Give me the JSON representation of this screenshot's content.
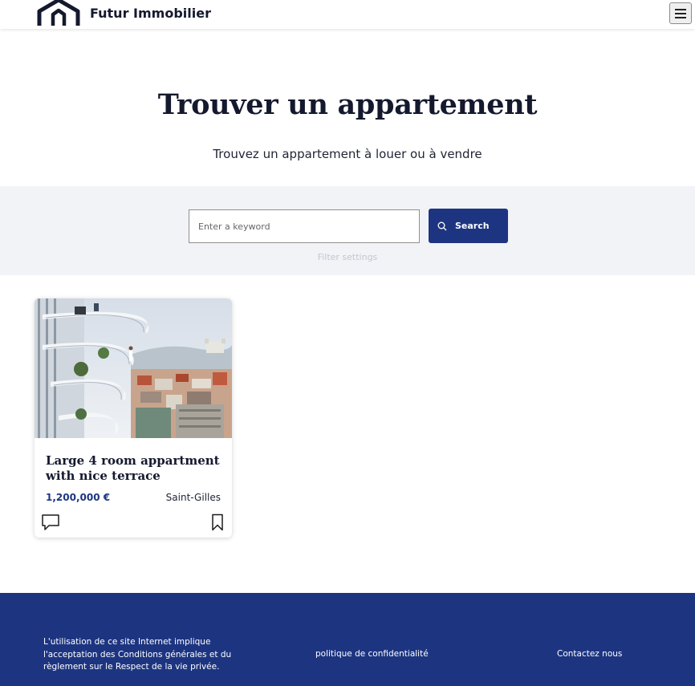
{
  "header": {
    "brand": "Futur Immobilier",
    "logo_icon": "house-outline-icon",
    "menu_icon": "hamburger-menu-icon"
  },
  "hero": {
    "title": "Trouver un appartement",
    "subtitle": "Trouvez un appartement à louer ou à vendre"
  },
  "search": {
    "placeholder": "Enter a keyword",
    "value": "",
    "button_label": "Search",
    "button_icon": "search-icon",
    "filter_link": "Filter settings"
  },
  "listings": [
    {
      "title": "Large 4 room appartment with nice terrace",
      "price": "1,200,000 €",
      "city": "Saint-Gilles",
      "image": "apartment-tower-balconies-photo",
      "icons": [
        "comment-icon",
        "bookmark-icon"
      ]
    }
  ],
  "footer": {
    "legal": "L'utilisation de ce site Internet implique l'acceptation des Conditions générales et du règlement sur le Respect de la vie privée.",
    "privacy": "politique de confidentialité",
    "contact": "Contactez nous"
  },
  "colors": {
    "primary": "#1d3581",
    "search_band": "#f2f3f7",
    "text_dark": "#14192e"
  }
}
